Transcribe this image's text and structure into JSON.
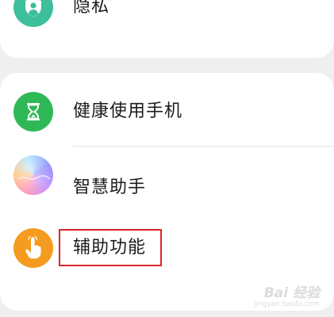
{
  "settings": {
    "items": [
      {
        "label": "隐私",
        "icon": "privacy-shield-icon",
        "color": "#3cbf9a"
      },
      {
        "label": "健康使用手机",
        "icon": "hourglass-icon",
        "color": "#2fb956"
      },
      {
        "label": "智慧助手",
        "icon": "smart-assistant-gradient-icon",
        "color": "#9aa8ff"
      },
      {
        "label": "辅助功能",
        "icon": "hand-pointer-icon",
        "color": "#f59b1f"
      }
    ],
    "highlight_color": "#d9262b"
  },
  "watermark": {
    "main": "Bai 经验",
    "sub": "jingyan.baidu.com"
  }
}
